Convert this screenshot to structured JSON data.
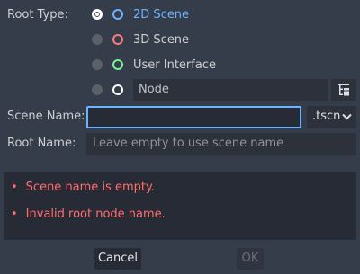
{
  "form": {
    "root_type_label": "Root Type:",
    "options": [
      {
        "label": "2D Scene",
        "ring_color": "#6ab4ff",
        "selected": true
      },
      {
        "label": "3D Scene",
        "ring_color": "#ff7b7b",
        "selected": false
      },
      {
        "label": "User Interface",
        "ring_color": "#7bf29c",
        "selected": false
      },
      {
        "label": "Node",
        "ring_color": "#ffffff",
        "selected": false
      }
    ],
    "scene_name_label": "Scene Name:",
    "scene_name_value": "",
    "extension": ".tscn",
    "root_name_label": "Root Name:",
    "root_name_placeholder": "Leave empty to use scene name"
  },
  "errors": [
    "Scene name is empty.",
    "Invalid root node name."
  ],
  "buttons": {
    "cancel": "Cancel",
    "ok": "OK"
  },
  "icons": {
    "node_picker": "tree-icon",
    "dropdown": "chevron-down-icon"
  },
  "colors": {
    "background": "#363d4a",
    "accent": "#6ab4ff",
    "error": "#ff6e6e"
  }
}
